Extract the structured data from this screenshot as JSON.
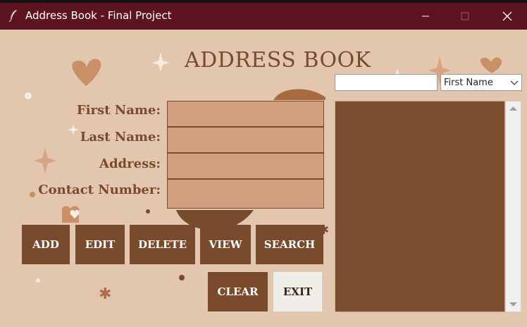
{
  "window": {
    "title": "Address Book - Final Project",
    "icons": {
      "app": "feather-icon",
      "minimize": "minimize-icon",
      "maximize": "maximize-icon",
      "close": "close-icon"
    },
    "titlebar_color": "#5e1420"
  },
  "main": {
    "heading": "ADDRESS BOOK",
    "form": {
      "labels": {
        "first_name": "First Name:",
        "last_name": "Last Name:",
        "address": "Address:",
        "contact_number": "Contact Number:"
      },
      "values": {
        "first_name": "",
        "last_name": "",
        "address": "",
        "contact_number": ""
      }
    },
    "buttons": {
      "add": "ADD",
      "edit": "EDIT",
      "delete": "DELETE",
      "view": "VIEW",
      "search": "SEARCH",
      "clear": "CLEAR",
      "exit": "EXIT"
    }
  },
  "search_panel": {
    "query_value": "",
    "field_select": {
      "selected": "First Name"
    },
    "results": []
  },
  "colors": {
    "background": "#e2c7ae",
    "accent_brown": "#7a4a2c",
    "field_fill": "#d19f7d",
    "list_fill": "#7a4e2f"
  }
}
